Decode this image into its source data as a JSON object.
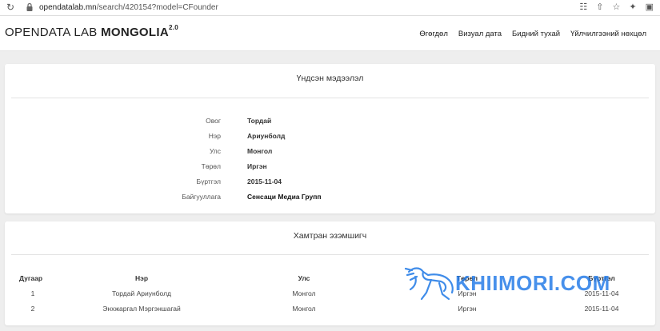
{
  "browser": {
    "url_domain": "opendatalab.mn",
    "url_path": "/search/420154?model=CFounder"
  },
  "header": {
    "logo_light": "OPENDATA LAB ",
    "logo_bold": "MONGOLIA",
    "logo_sup": "2.0",
    "nav": [
      "Өгөгдөл",
      "Визуал дата",
      "Бидний тухай",
      "Үйлчилгээний нөхцөл"
    ]
  },
  "basic_info": {
    "title": "Үндсэн мэдээлэл",
    "rows": [
      {
        "label": "Овог",
        "value": "Тордай"
      },
      {
        "label": "Нэр",
        "value": "Ариунболд"
      },
      {
        "label": "Улс",
        "value": "Монгол"
      },
      {
        "label": "Төрөл",
        "value": "Иргэн"
      },
      {
        "label": "Бүртгэл",
        "value": "2015-11-04"
      },
      {
        "label": "Байгууллага",
        "value": "Сенсаци Медиа Групп"
      }
    ]
  },
  "co_owners": {
    "title": "Хамтран эзэмшигч",
    "columns": [
      "Дугаар",
      "Нэр",
      "Улс",
      "Төрөл",
      "Бүртгэл"
    ],
    "rows": [
      [
        "1",
        "Тордай Ариунболд",
        "Монгол",
        "Иргэн",
        "2015-11-04"
      ],
      [
        "2",
        "Энхжаргал Мэргэншагай",
        "Монгол",
        "Иргэн",
        "2015-11-04"
      ]
    ]
  },
  "watermark": {
    "text": "KHIIMORI.COM",
    "color": "#1e78e6"
  }
}
